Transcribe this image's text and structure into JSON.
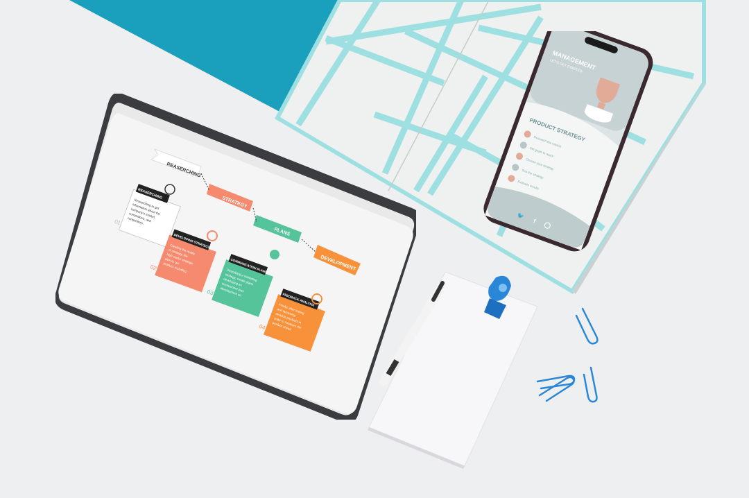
{
  "tablet": {
    "steps": [
      "REASERCHING",
      "STRATEGY",
      "PLANS",
      "DEVELOPMENT"
    ],
    "cards": [
      {
        "title": "REASERCHING",
        "body": [
          "Researching to get",
          "information about the",
          "company's market,",
          "competitors, and",
          "competitors."
        ],
        "num": "01",
        "color": "#ffffff"
      },
      {
        "title": "DEVELOPING STRATEGY",
        "body": [
          "Creating the reality",
          "of strategy, the",
          "high sector strategic",
          "plan to our",
          "product, including"
        ],
        "num": "02",
        "color": "#f58a6f"
      },
      {
        "title": "COMMUNICATION PLANS",
        "body": [
          "Describing a marketing",
          "strategy, create plans",
          "developing an",
          "involvement plan",
          "development on"
        ],
        "num": "03",
        "color": "#55c49a"
      },
      {
        "title": "FEEDBACK ANALYSIS",
        "body": [
          "Finally, after testing",
          "and launching",
          "develop products in",
          "order to measure the",
          "product ahead"
        ],
        "num": "04",
        "color": "#f7913a"
      }
    ]
  },
  "phone": {
    "title": "MANAGEMENT",
    "subtitle": "LET'S GET STARTED",
    "section": "PRODUCT STRATEGY",
    "items": [
      "Research the market",
      "Set goals to reach",
      "Choose your strategy",
      "Test the strategy",
      "Evaluate results"
    ]
  },
  "colors": {
    "teal": "#1aa0bd",
    "notebook_line": "#9ee0e2",
    "orange": "#f58a6f",
    "green": "#55c49a",
    "amber": "#f7913a",
    "clip_blue": "#2a86d6"
  }
}
